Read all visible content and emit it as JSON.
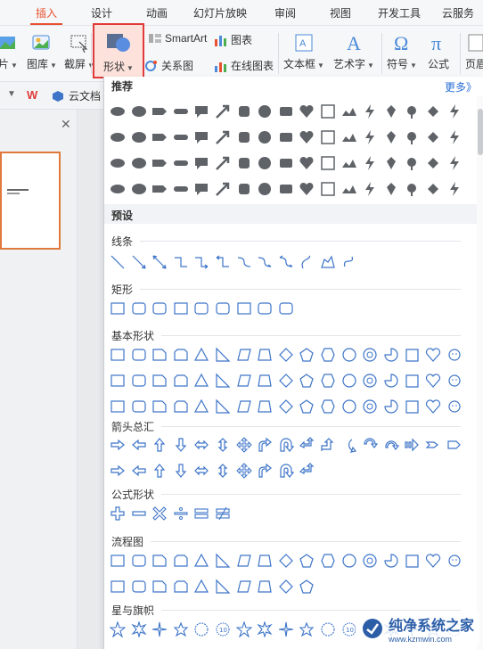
{
  "tabs": [
    {
      "label": "插入",
      "active": true
    },
    {
      "label": "设计"
    },
    {
      "label": "动画"
    },
    {
      "label": "幻灯片放映"
    },
    {
      "label": "审阅"
    },
    {
      "label": "视图"
    },
    {
      "label": "开发工具"
    },
    {
      "label": "云服务"
    }
  ],
  "ribbon": {
    "picture_label": "片",
    "gallery_label": "图库",
    "screenshot_label": "截屏",
    "shapes_label": "形状",
    "smartart_label": "SmartArt",
    "chart_label": "图表",
    "relation_label": "关系图",
    "online_chart_label": "在线图表",
    "textbox_label": "文本框",
    "wordart_label": "艺术字",
    "symbol_label": "符号",
    "formula_label": "公式",
    "header_label": "页眉"
  },
  "toolbar2": {
    "cloud_doc_label": "云文档"
  },
  "dropdown": {
    "recommended_title": "推荐",
    "more_label": "更多》",
    "preset_title": "预设",
    "categories": [
      "线条",
      "矩形",
      "基本形状",
      "箭头总汇",
      "公式形状",
      "流程图",
      "星与旗帜"
    ]
  },
  "watermark": {
    "title": "纯净系统之家",
    "url": "www.kzmwin.com"
  },
  "colors": {
    "accent": "#e8502f",
    "highlight_border": "#e03a3a",
    "shape_outline": "#3e75c8",
    "more_link": "#2b6fd6"
  }
}
